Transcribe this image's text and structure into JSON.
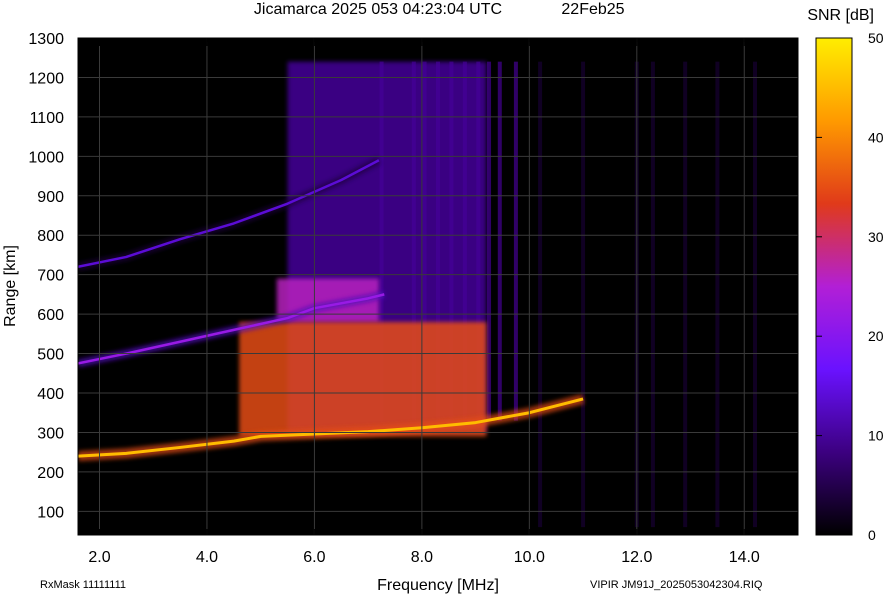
{
  "header": {
    "title": "Jicamarca 2025 053 04:23:04 UTC",
    "date_label": "22Feb25"
  },
  "footer": {
    "rx_mask": "RxMask 11111111",
    "file_label": "VIPIR  JM91J_2025053042304.RIQ"
  },
  "colors": {
    "plot_background": "#000000",
    "grid": "#3a3a3a",
    "colorbar_stops": [
      "#000000",
      "#3c0080",
      "#6a12ff",
      "#b21fd6",
      "#e03a1a",
      "#ff9a00",
      "#ffee00"
    ]
  },
  "chart_data": {
    "type": "heatmap",
    "xlabel": "Frequency [MHz]",
    "ylabel": "Range [km]",
    "xlim": [
      1.6,
      15.0
    ],
    "ylim": [
      40,
      1300
    ],
    "xticks": [
      2.0,
      4.0,
      6.0,
      8.0,
      10.0,
      12.0,
      14.0
    ],
    "xtick_labels": [
      "2.0",
      "4.0",
      "6.0",
      "8.0",
      "10.0",
      "12.0",
      "14.0"
    ],
    "yticks": [
      100,
      200,
      300,
      400,
      500,
      600,
      700,
      800,
      900,
      1000,
      1100,
      1200,
      1300
    ],
    "ytick_labels": [
      "100",
      "200",
      "300",
      "400",
      "500",
      "600",
      "700",
      "800",
      "900",
      "1000",
      "1100",
      "1200",
      "1300"
    ],
    "grid": true,
    "colorbar": {
      "label": "SNR [dB]",
      "range": [
        0,
        50
      ],
      "ticks": [
        0,
        10,
        20,
        30,
        40,
        50
      ],
      "tick_labels": [
        "0",
        "10",
        "20",
        "30",
        "40",
        "50"
      ]
    },
    "traces": [
      {
        "name": "first-hop F trace",
        "x": [
          1.6,
          2.5,
          3.5,
          4.5,
          5.0,
          6.0,
          7.0,
          8.0,
          9.0,
          10.0,
          11.0
        ],
        "y": [
          240,
          247,
          262,
          278,
          290,
          296,
          302,
          312,
          325,
          350,
          385
        ],
        "snr": 45
      },
      {
        "name": "second-hop trace",
        "x": [
          1.6,
          2.5,
          3.5,
          4.5,
          5.5,
          6.0,
          7.0,
          7.3
        ],
        "y": [
          475,
          500,
          530,
          560,
          590,
          615,
          640,
          650
        ],
        "snr": 22
      },
      {
        "name": "third-hop trace",
        "x": [
          1.6,
          2.5,
          3.5,
          4.5,
          5.5,
          6.5,
          7.2
        ],
        "y": [
          720,
          745,
          790,
          830,
          880,
          940,
          990
        ],
        "snr": 14
      }
    ],
    "regions": [
      {
        "name": "F-layer echo patch",
        "x_range": [
          4.6,
          9.2
        ],
        "y_range": [
          290,
          580
        ],
        "snr": 35
      },
      {
        "name": "second-hop patch",
        "x_range": [
          5.3,
          7.2
        ],
        "y_range": [
          580,
          690
        ],
        "snr": 26
      },
      {
        "name": "spread echoes",
        "x_range": [
          5.5,
          9.2
        ],
        "y_range": [
          300,
          1240
        ],
        "snr": 10
      }
    ],
    "bright_columns_mhz": [
      7.25,
      7.85,
      8.05,
      8.3,
      8.55,
      8.8,
      9.05,
      9.25,
      9.45,
      9.75,
      10.2,
      11.0,
      12.0,
      12.3,
      12.9,
      13.5,
      14.2
    ]
  }
}
